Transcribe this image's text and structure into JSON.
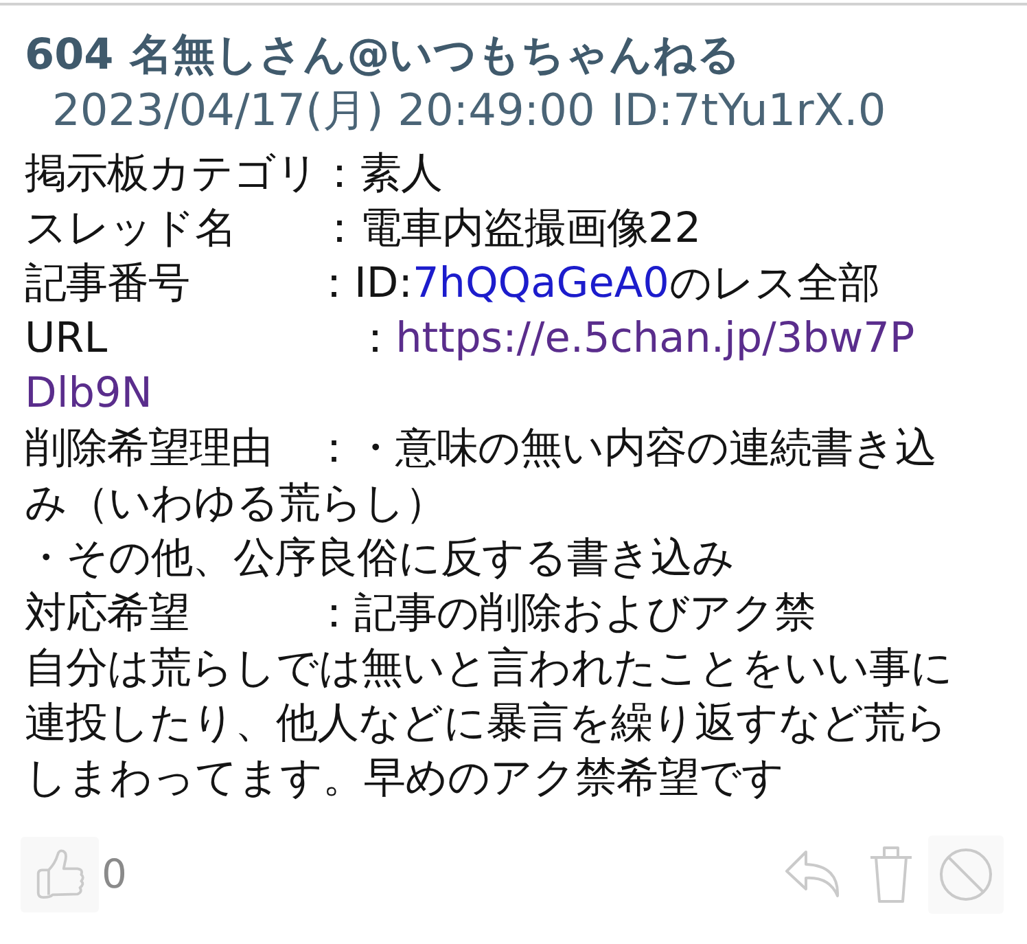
{
  "post": {
    "number": "604",
    "author": "名無しさん@いつもちゃんねる",
    "date": "2023/04/17(月) 20:49:00",
    "poster_id": "ID:7tYu1rX.0",
    "body": [
      [
        {
          "kind": "text",
          "text": "掲示板カテゴリ：素人"
        }
      ],
      [
        {
          "kind": "text",
          "text": "スレッド名　　：電車内盗撮画像22"
        }
      ],
      [
        {
          "kind": "text",
          "text": "記事番号　　　：ID:"
        },
        {
          "kind": "link",
          "text": "7hQQaGeA0",
          "visited": false
        },
        {
          "kind": "text",
          "text": "のレス全部"
        }
      ],
      [
        {
          "kind": "text",
          "text": "URL　　　　　　："
        },
        {
          "kind": "link",
          "text": "https://e.5chan.jp/3bw7P",
          "visited": true
        }
      ],
      [
        {
          "kind": "link",
          "text": "Dlb9N",
          "visited": true
        }
      ],
      [
        {
          "kind": "text",
          "text": "削除希望理由　：・意味の無い内容の連続書き込み（いわゆる荒らし）"
        }
      ],
      [
        {
          "kind": "text",
          "text": "・その他、公序良俗に反する書き込み"
        }
      ],
      [
        {
          "kind": "text",
          "text": "対応希望　　　：記事の削除およびアク禁"
        }
      ],
      [
        {
          "kind": "text",
          "text": "自分は荒らしでは無いと言われたことをいい事に連投したり、他人などに暴言を繰り返すなど荒らしまわってます。早めのアク禁希望です"
        }
      ]
    ]
  },
  "actions": {
    "like_count": "0"
  }
}
